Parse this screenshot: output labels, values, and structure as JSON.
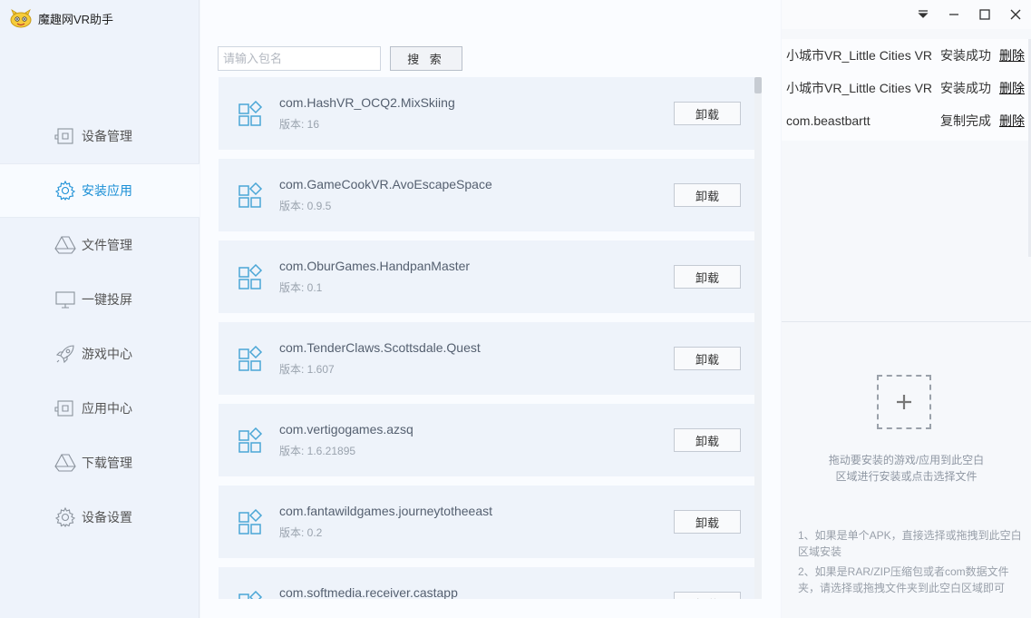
{
  "app": {
    "title": "魔趣网VR助手"
  },
  "sidebar": {
    "items": [
      {
        "id": "device",
        "label": "设备管理",
        "icon": "device-icon",
        "active": false
      },
      {
        "id": "install",
        "label": "安装应用",
        "icon": "gear-icon",
        "active": true
      },
      {
        "id": "files",
        "label": "文件管理",
        "icon": "drive-icon",
        "active": false
      },
      {
        "id": "cast",
        "label": "一键投屏",
        "icon": "monitor-icon",
        "active": false
      },
      {
        "id": "games",
        "label": "游戏中心",
        "icon": "rocket-icon",
        "active": false
      },
      {
        "id": "apps",
        "label": "应用中心",
        "icon": "device-icon",
        "active": false
      },
      {
        "id": "downloads",
        "label": "下载管理",
        "icon": "drive-icon",
        "active": false
      },
      {
        "id": "settings",
        "label": "设备设置",
        "icon": "gear-icon",
        "active": false
      }
    ]
  },
  "search": {
    "placeholder": "请输入包名",
    "button_label": "搜 索"
  },
  "apps": [
    {
      "name": "com.HashVR_OCQ2.MixSkiing",
      "version": "版本: 16",
      "action": "卸载"
    },
    {
      "name": "com.GameCookVR.AvoEscapeSpace",
      "version": "版本: 0.9.5",
      "action": "卸载"
    },
    {
      "name": "com.OburGames.HandpanMaster",
      "version": "版本: 0.1",
      "action": "卸载"
    },
    {
      "name": "com.TenderClaws.Scottsdale.Quest",
      "version": "版本: 1.607",
      "action": "卸载"
    },
    {
      "name": "com.vertigogames.azsq",
      "version": "版本: 1.6.21895",
      "action": "卸载"
    },
    {
      "name": "com.fantawildgames.journeytotheeast",
      "version": "版本: 0.2",
      "action": "卸载"
    },
    {
      "name": "com.softmedia.receiver.castapp",
      "version": "",
      "action": "卸载"
    }
  ],
  "tasks": [
    {
      "name": "小城市VR_Little Cities VR",
      "status": "安装成功",
      "delete": "删除"
    },
    {
      "name": "小城市VR_Little Cities VR",
      "status": "安装成功",
      "delete": "删除"
    },
    {
      "name": "com.beastbartt",
      "status": "复制完成",
      "delete": "删除"
    }
  ],
  "drop_zone": {
    "hint_line1": "拖动要安装的游戏/应用到此空白",
    "hint_line2": "区域进行安装或点击选择文件",
    "icon": "plus-icon"
  },
  "notes": [
    "1、如果是单个APK，直接选择或拖拽到此空白区域安装",
    "2、如果是RAR/ZIP压缩包或者com数据文件夹，请选择或拖拽文件夹到此空白区域即可"
  ],
  "colors": {
    "accent": "#1a8fd6",
    "app_icon": "#4aa6d6"
  }
}
